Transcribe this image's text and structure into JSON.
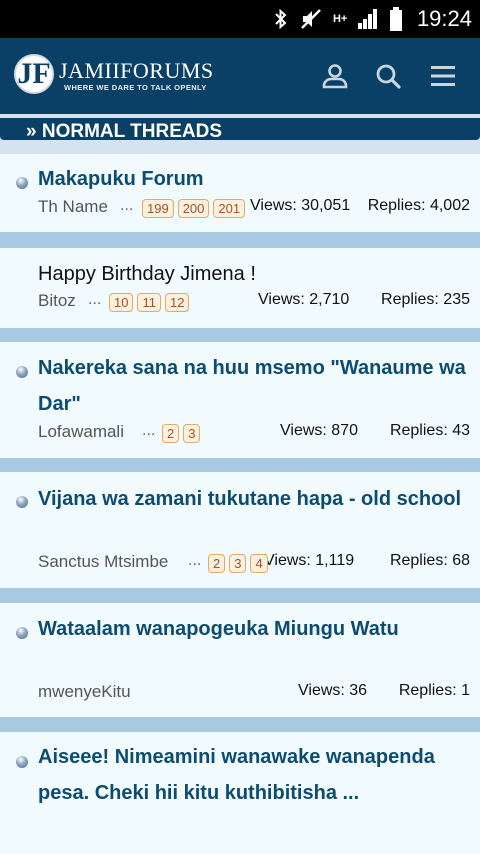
{
  "status_bar": {
    "time": "19:24",
    "hplus_label": "H+",
    "icons": [
      "bluetooth-icon",
      "mute-icon",
      "signal-icon",
      "battery-icon"
    ]
  },
  "header": {
    "logo_mark": "JF",
    "logo_name": "JAMIIFORUMS",
    "logo_tagline": "WHERE WE DARE TO TALK OPENLY",
    "icons": [
      "user-icon",
      "search-icon",
      "menu-icon"
    ],
    "background_color": "#0a4066"
  },
  "section": {
    "title": "» NORMAL THREADS"
  },
  "threads": [
    {
      "title": "Makapuku Forum",
      "author": "Th Name",
      "ellipsis": "...",
      "pages": [
        "199",
        "200",
        "201"
      ],
      "views": "Views: 30,051",
      "replies": "Replies: 4,002",
      "unread": true
    },
    {
      "title": "Happy Birthday Jimena !",
      "author": "Bitoz",
      "ellipsis": "...",
      "pages": [
        "10",
        "11",
        "12"
      ],
      "views": "Views: 2,710",
      "replies": "Replies: 235",
      "unread": false
    },
    {
      "title": "Nakereka sana na huu msemo \"Wanaume wa Dar\"",
      "author": "Lofawamali",
      "ellipsis": "...",
      "pages": [
        "2",
        "3"
      ],
      "views": "Views: 870",
      "replies": "Replies: 43",
      "unread": true
    },
    {
      "title": "Vijana wa zamani tukutane hapa - old school",
      "author": "Sanctus Mtsimbe",
      "ellipsis": "...",
      "pages": [
        "2",
        "3",
        "4"
      ],
      "views": "Views: 1,119",
      "replies": "Replies: 68",
      "unread": true
    },
    {
      "title": "Wataalam wanapogeuka Miungu Watu",
      "author": "mwenyeKitu",
      "ellipsis": "",
      "pages": [],
      "views": "Views: 36",
      "replies": "Replies: 1",
      "unread": true
    },
    {
      "title": "Aiseee! Nimeamini wanawake wanapenda pesa. Cheki hii kitu kuthibitisha ...",
      "author": "",
      "ellipsis": "",
      "pages": [],
      "views": "",
      "replies": "",
      "unread": true
    }
  ]
}
